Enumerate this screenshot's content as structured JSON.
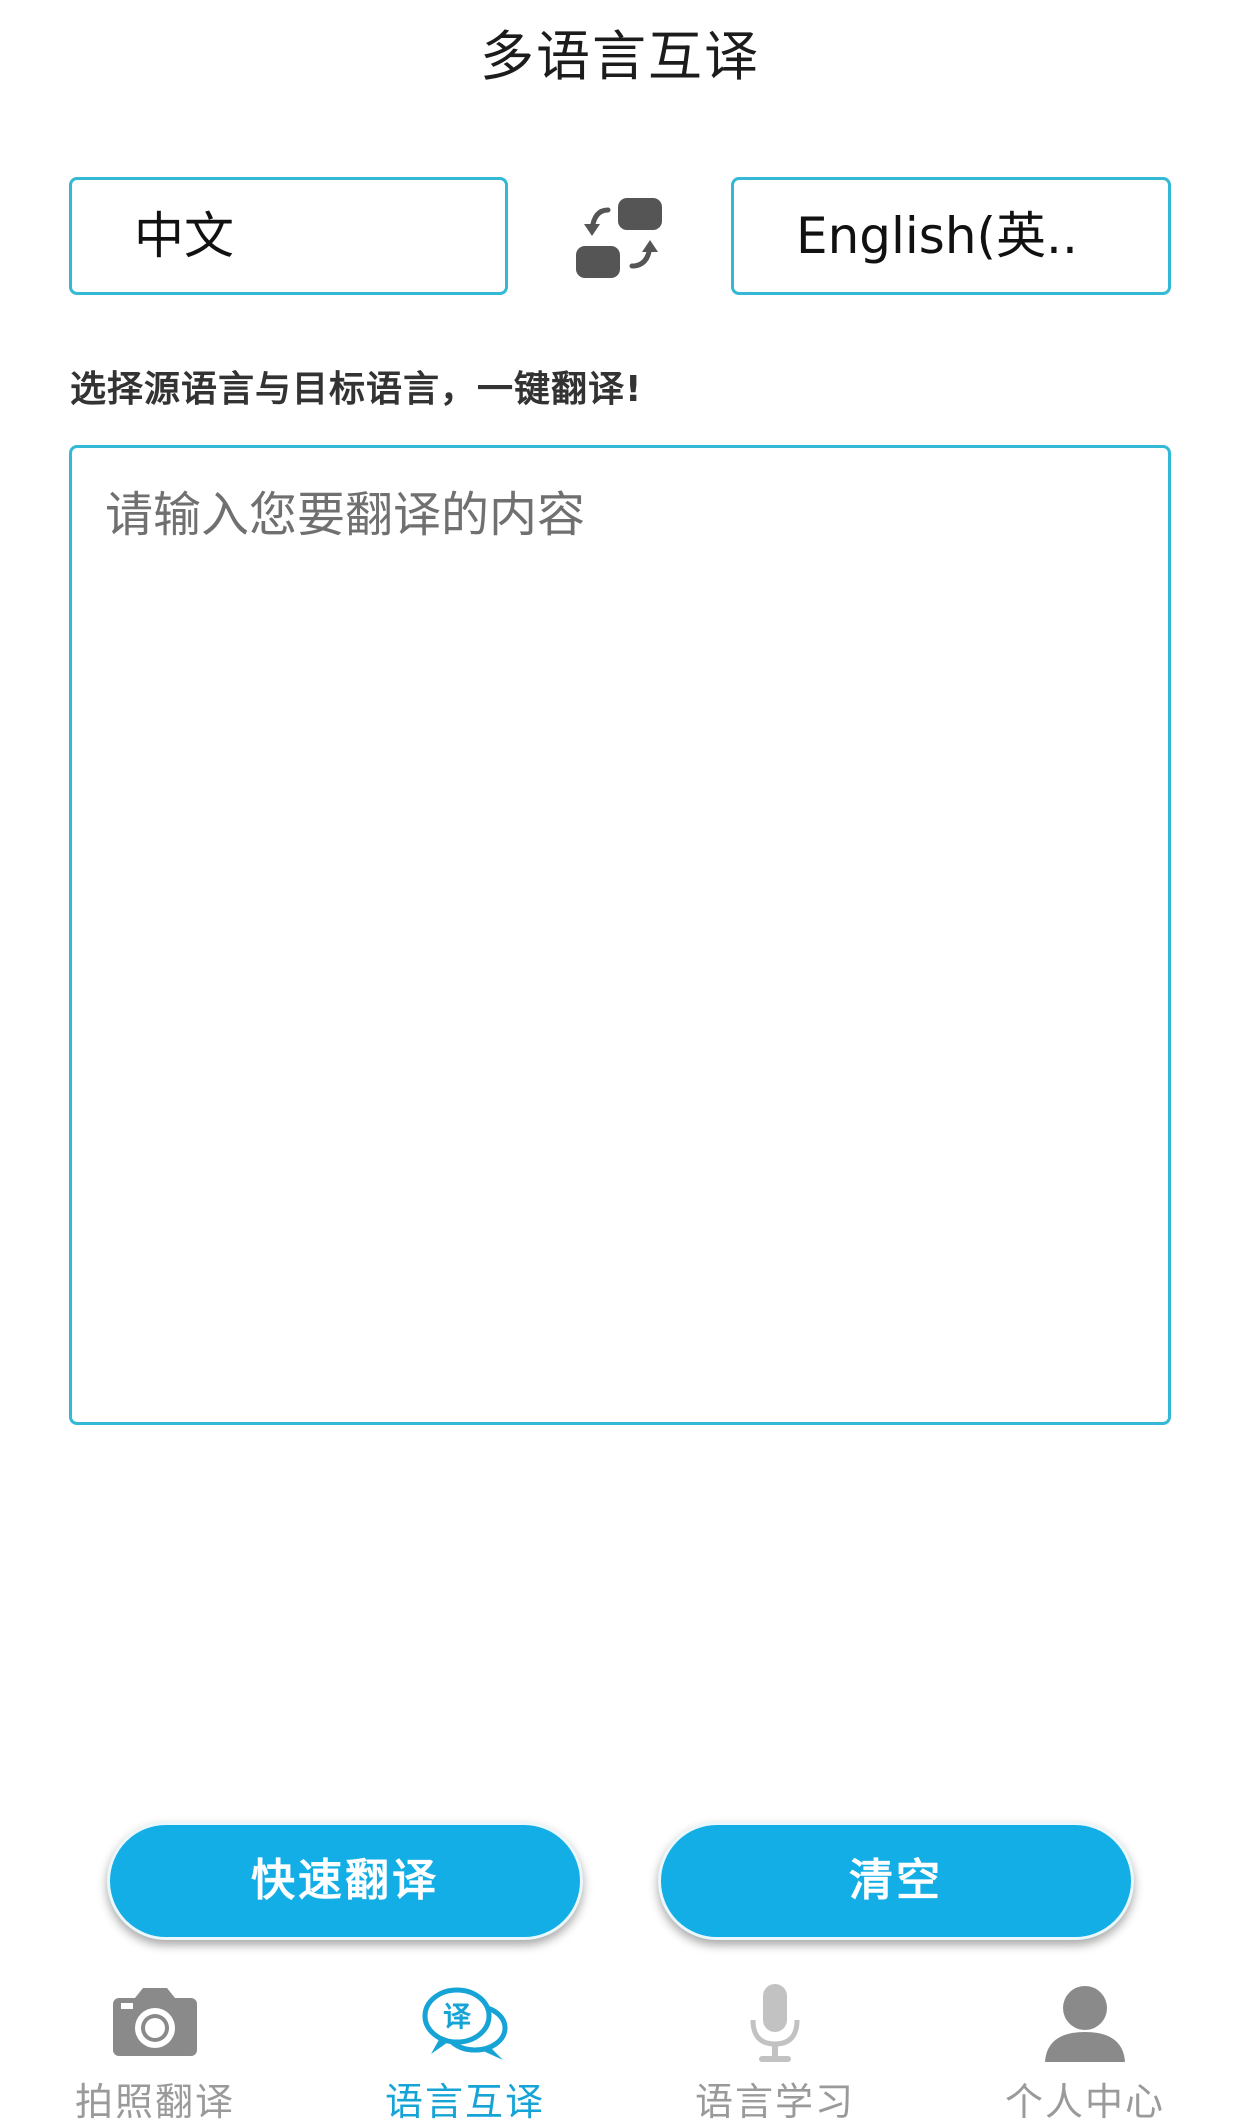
{
  "header": {
    "title": "多语言互译"
  },
  "languages": {
    "source": "中文",
    "target": "English(英.."
  },
  "hint": "选择源语言与目标语言，一键翻译!",
  "input": {
    "placeholder": "请输入您要翻译的内容",
    "value": ""
  },
  "actions": {
    "translate_label": "快速翻译",
    "clear_label": "清空"
  },
  "tabs": [
    {
      "label": "拍照翻译",
      "icon": "camera-icon",
      "active": false
    },
    {
      "label": "语言互译",
      "icon": "translate-chat-icon",
      "active": true
    },
    {
      "label": "语言学习",
      "icon": "microphone-icon",
      "active": false
    },
    {
      "label": "个人中心",
      "icon": "user-icon",
      "active": false
    }
  ],
  "colors": {
    "accent": "#13aee6",
    "border": "#33b8d6",
    "tab_active": "#16a3d6",
    "tab_inactive": "#9a9a9a",
    "icon_dark": "#555555"
  }
}
